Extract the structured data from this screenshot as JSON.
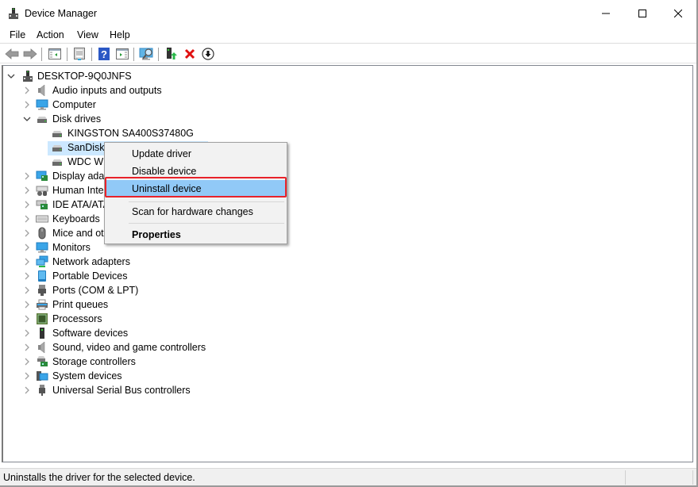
{
  "window": {
    "title": "Device Manager",
    "controls": {
      "minimize": "—",
      "maximize": "☐",
      "close": "✕"
    }
  },
  "menubar": {
    "items": [
      "File",
      "Action",
      "View",
      "Help"
    ]
  },
  "toolbar": {
    "buttons": [
      {
        "icon": "back-arrow-icon"
      },
      {
        "icon": "forward-arrow-icon"
      },
      {
        "icon": "show-hide-console-tree-icon"
      },
      {
        "icon": "properties-icon"
      },
      {
        "icon": "help-icon"
      },
      {
        "icon": "show-action-pane-icon"
      },
      {
        "icon": "scan-hardware-changes-icon"
      },
      {
        "icon": "update-driver-icon"
      },
      {
        "icon": "uninstall-device-icon"
      },
      {
        "icon": "enable-device-icon"
      }
    ]
  },
  "tree": {
    "root": {
      "label": "DESKTOP-9Q0JNFS",
      "icon": "computer-tower-icon",
      "expanded": true
    },
    "categories": [
      {
        "label": "Audio inputs and outputs",
        "icon": "speaker-icon",
        "expanded": false
      },
      {
        "label": "Computer",
        "icon": "monitor-icon",
        "expanded": false
      },
      {
        "label": "Disk drives",
        "icon": "disk-drive-icon",
        "expanded": true,
        "children": [
          {
            "label": "KINGSTON SA400S37480G",
            "icon": "disk-drive-icon"
          },
          {
            "label": "SanDisk",
            "icon": "disk-drive-icon",
            "selected": true
          },
          {
            "label": "WDC WD",
            "icon": "disk-drive-icon"
          }
        ]
      },
      {
        "label": "Display adap",
        "icon": "display-adapter-icon",
        "expanded": false
      },
      {
        "label": "Human Inte",
        "icon": "hid-icon",
        "expanded": false
      },
      {
        "label": "IDE ATA/ATA",
        "icon": "ide-controller-icon",
        "expanded": false
      },
      {
        "label": "Keyboards",
        "icon": "keyboard-icon",
        "expanded": false
      },
      {
        "label": "Mice and ot",
        "icon": "mouse-icon",
        "expanded": false
      },
      {
        "label": "Monitors",
        "icon": "monitor-icon",
        "expanded": false
      },
      {
        "label": "Network adapters",
        "icon": "network-icon",
        "expanded": false
      },
      {
        "label": "Portable Devices",
        "icon": "portable-device-icon",
        "expanded": false
      },
      {
        "label": "Ports (COM & LPT)",
        "icon": "port-icon",
        "expanded": false
      },
      {
        "label": "Print queues",
        "icon": "printer-icon",
        "expanded": false
      },
      {
        "label": "Processors",
        "icon": "processor-icon",
        "expanded": false
      },
      {
        "label": "Software devices",
        "icon": "software-device-icon",
        "expanded": false
      },
      {
        "label": "Sound, video and game controllers",
        "icon": "speaker-icon",
        "expanded": false
      },
      {
        "label": "Storage controllers",
        "icon": "storage-controller-icon",
        "expanded": false
      },
      {
        "label": "System devices",
        "icon": "system-device-icon",
        "expanded": false
      },
      {
        "label": "Universal Serial Bus controllers",
        "icon": "usb-icon",
        "expanded": false
      }
    ]
  },
  "context_menu": {
    "items": [
      {
        "label": "Update driver"
      },
      {
        "label": "Disable device"
      },
      {
        "label": "Uninstall device",
        "highlighted": true
      },
      {
        "label": "Scan for hardware changes"
      },
      {
        "label": "Properties",
        "bold": true
      }
    ],
    "highlight_color": "#91c9f7",
    "outline_color": "#e8222a"
  },
  "statusbar": {
    "text": "Uninstalls the driver for the selected device."
  }
}
